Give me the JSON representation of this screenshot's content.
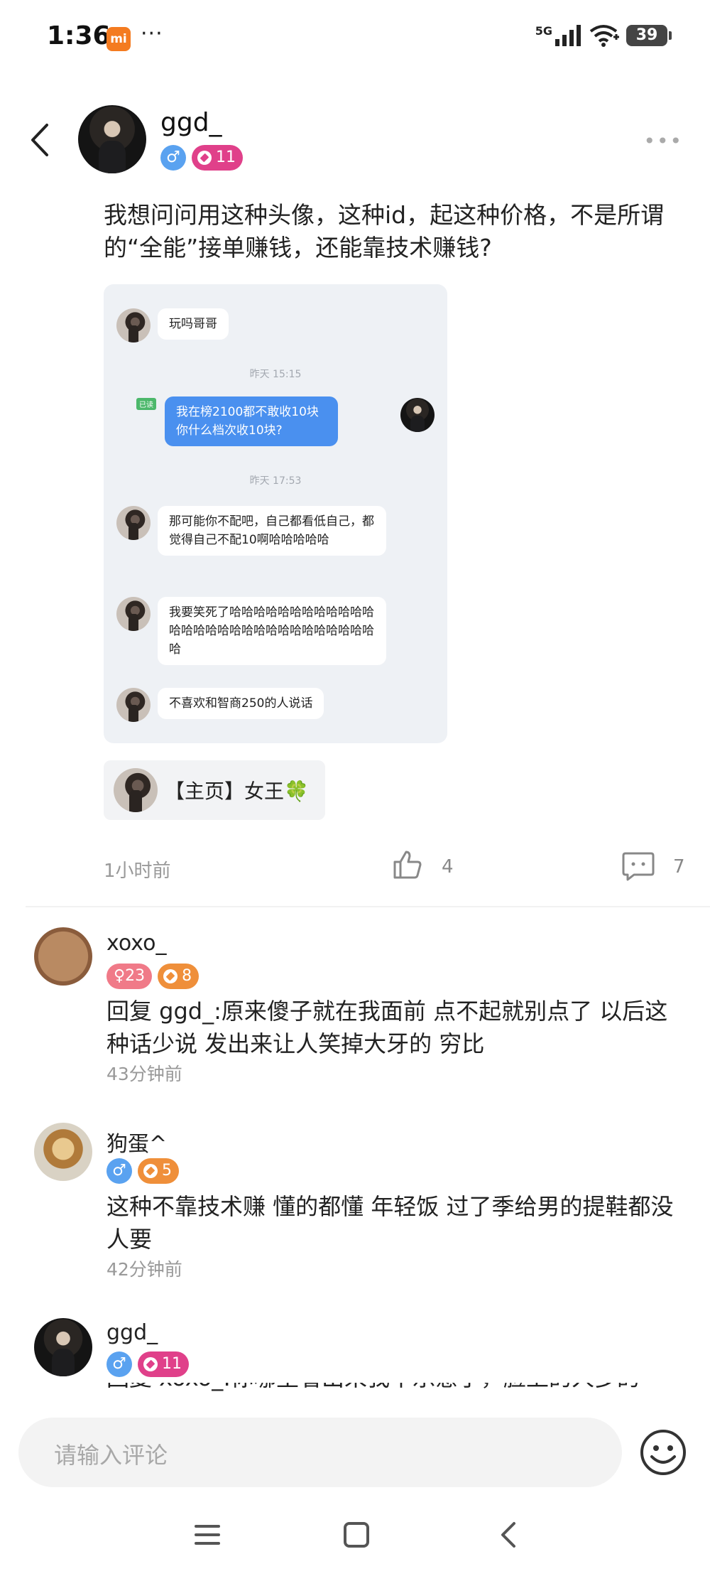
{
  "status_bar": {
    "time": "1:36",
    "mi_label": "mi",
    "dots": "···",
    "network": "5G",
    "battery": "39"
  },
  "post": {
    "author": "ggd_",
    "level": "11",
    "text": "我想问问用这种头像，这种id，起这种价格，不是所谓的“全能”接单赚钱，还能靠技术赚钱?",
    "screenshot": {
      "read_label": "已读",
      "ts1": "昨天 15:15",
      "ts2": "昨天 17:53",
      "msg1": "玩吗哥哥",
      "msg2": "我在榜2100都不敢收10块你什么档次收10块?",
      "msg3": "那可能你不配吧，自己都看低自己，都觉得自己不配10啊哈哈哈哈哈",
      "msg4": "我要笑死了哈哈哈哈哈哈哈哈哈哈哈哈哈哈哈哈哈哈哈哈哈哈哈哈哈哈哈哈哈哈",
      "msg5": "不喜欢和智商250的人说话"
    },
    "homepage_chip": "【主页】女王🍀",
    "time": "1小时前",
    "likes": "4",
    "comments": "7"
  },
  "comments": [
    {
      "name": "xoxo_",
      "gender_age": "♀23",
      "level": "8",
      "text": "回复 ggd_:原来傻子就在我面前 点不起就别点了 以后这种话少说 发出来让人笑掉大牙的 穷比",
      "time": "43分钟前"
    },
    {
      "name": "狗蛋^",
      "level": "5",
      "text": "这种不靠技术赚 懂的都懂 年轻饭 过了季给男的提鞋都没人要",
      "time": "42分钟前"
    },
    {
      "name": "ggd_",
      "level": "11",
      "text": "回复 xoxo_:你哪里看出来我不乐意了，脸上的人多的"
    }
  ],
  "input": {
    "placeholder": "请输入评论"
  },
  "colors": {
    "male_badge": "#5aa2f0",
    "level_pink": "#e0408a",
    "level_orange": "#ef8f3a",
    "female_badge": "#f07a88",
    "chat_blue": "#4a90ef"
  }
}
